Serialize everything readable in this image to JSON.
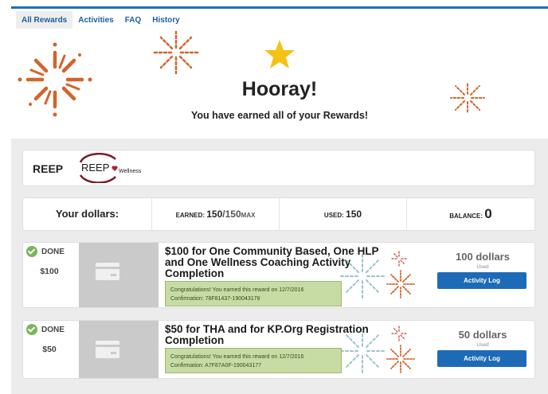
{
  "tabs": [
    {
      "label": "All Rewards",
      "active": true
    },
    {
      "label": "Activities",
      "active": false
    },
    {
      "label": "FAQ",
      "active": false
    },
    {
      "label": "History",
      "active": false
    }
  ],
  "hero": {
    "title": "Hooray!",
    "subtitle": "You have earned all of your Rewards!",
    "icons": [
      "star-icon",
      "firework-icon"
    ]
  },
  "program": {
    "label": "REEP",
    "logo_text": "REEP",
    "logo_sub": "Wellness"
  },
  "dollars": {
    "label": "Your dollars:",
    "earned_label": "EARNED:",
    "earned_value": "150",
    "earned_slash": "/",
    "earned_max": "150",
    "earned_max_suffix": "MAX",
    "used_label": "USED:",
    "used_value": "150",
    "balance_label": "BALANCE:",
    "balance_value": "0"
  },
  "rewards": [
    {
      "status": "DONE",
      "amount": "$100",
      "title_lines": [
        "$100 for One Community Based, One HLP",
        "and One Wellness Coaching Activity",
        "Completion"
      ],
      "congrats": "Congratulations! You earned this reward on 12/7/2016",
      "confirmation": "Confirmation: 78F81437-190043178",
      "dollars": "100 dollars",
      "used": "Used",
      "button": "Activity Log"
    },
    {
      "status": "DONE",
      "amount": "$50",
      "title_lines": [
        "$50 for THA and for KP.Org Registration",
        "Completion"
      ],
      "congrats": "Congratulations! You earned this reward on 12/7/2016",
      "confirmation": "Confirmation: A7F87A0F-190043177",
      "dollars": "50 dollars",
      "used": "Used",
      "button": "Activity Log"
    }
  ],
  "colors": {
    "accent": "#1e6fb5",
    "button": "#1d6bb6",
    "done_check": "#7ab55c",
    "congrats_bg": "#c7dba4",
    "firework": "#d2642a",
    "star": "#f2c314"
  }
}
